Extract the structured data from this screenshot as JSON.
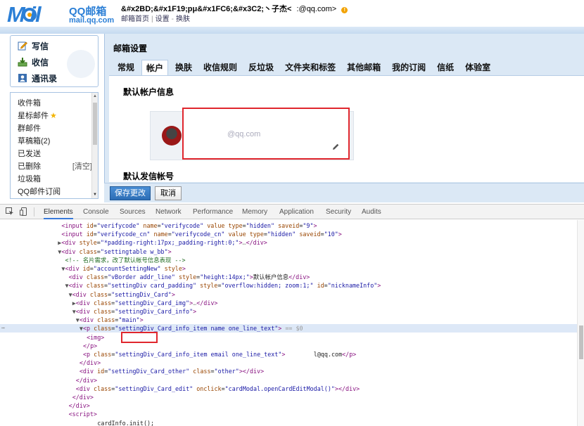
{
  "header": {
    "logo_text": "M il",
    "brand_name": "QQ邮箱",
    "brand_domain": "mail.qq.com",
    "user_name": "&#x2BD;&#x1F19;pμ&#x1FC6;&#x3C2;丶子杰<",
    "user_email": ":@qq.com>",
    "warn_icon": "!",
    "links": [
      "邮箱首页",
      "设置",
      "换肤"
    ]
  },
  "left": {
    "quick": [
      {
        "label": "写信",
        "icon": "write-icon"
      },
      {
        "label": "收信",
        "icon": "inbox-download-icon"
      },
      {
        "label": "通讯录",
        "icon": "contacts-icon"
      }
    ],
    "folders": [
      {
        "label": "收件箱"
      },
      {
        "label": "星标邮件",
        "star": "★"
      },
      {
        "label": "群邮件"
      },
      {
        "label": "草稿箱(2)"
      },
      {
        "label": "已发送"
      },
      {
        "label": "已删除",
        "action": "[清空]"
      },
      {
        "label": "垃圾箱"
      },
      {
        "label": "QQ邮件订阅"
      }
    ]
  },
  "main": {
    "title": "邮箱设置",
    "tabs": [
      "常规",
      "帐户",
      "换肤",
      "收信规则",
      "反垃圾",
      "文件夹和标签",
      "其他邮箱",
      "我的订阅",
      "信纸",
      "体验室"
    ],
    "active_tab": "帐户",
    "section_default_info": "默认帐户信息",
    "card_email": "@qq.com",
    "section_default_send": "默认发信帐号",
    "save_button": "保存更改",
    "cancel_button": "取消"
  },
  "devtools": {
    "tabs": [
      "Elements",
      "Console",
      "Sources",
      "Network",
      "Performance",
      "Memory",
      "Application",
      "Security",
      "Audits"
    ],
    "active_tab": "Elements",
    "lines": [
      {
        "indent": 14,
        "html": "<span class=\"tag\">&lt;input</span> <span class=\"at\">id</span>=<span class=\"av\">\"verifycode\"</span> <span class=\"at\">name</span>=<span class=\"av\">\"verifycode\"</span> <span class=\"at\">value</span> <span class=\"at\">type</span>=<span class=\"av\">\"hidden\"</span> <span class=\"at\">saveid</span>=<span class=\"av\">\"9\"</span><span class=\"tag\">&gt;</span>"
      },
      {
        "indent": 14,
        "html": "<span class=\"tag\">&lt;input</span> <span class=\"at\">id</span>=<span class=\"av\">\"verifycode_cn\"</span> <span class=\"at\">name</span>=<span class=\"av\">\"verifycode_cn\"</span> <span class=\"at\">value</span> <span class=\"at\">type</span>=<span class=\"av\">\"hidden\"</span> <span class=\"at\">saveid</span>=<span class=\"av\">\"10\"</span><span class=\"tag\">&gt;</span>"
      },
      {
        "indent": 13,
        "html": "<span class=\"tri\">▶</span><span class=\"tag\">&lt;div</span> <span class=\"at\">style</span>=<span class=\"av\">\"*padding-right:17px;_padding-right:0;\"</span><span class=\"tag\">&gt;</span><span class=\"ell\">…</span><span class=\"tag\">&lt;/div&gt;</span>"
      },
      {
        "indent": 13,
        "html": "<span class=\"tri\">▼</span><span class=\"tag\">&lt;div</span> <span class=\"at\">class</span>=<span class=\"av\">\"settingtable w_bb\"</span><span class=\"tag\">&gt;</span>"
      },
      {
        "indent": 15,
        "html": "<span class=\"cm\">&lt;!-- 名片需求，改了默认帐号信息表现 --&gt;</span>"
      },
      {
        "indent": 14,
        "html": "<span class=\"tri\">▼</span><span class=\"tag\">&lt;div</span> <span class=\"at\">id</span>=<span class=\"av\">\"accountSettingNew\"</span> <span class=\"at\">style</span><span class=\"tag\">&gt;</span>"
      },
      {
        "indent": 16,
        "html": "<span class=\"tag\">&lt;div</span> <span class=\"at\">class</span>=<span class=\"av\">\"vBorder addr_line\"</span> <span class=\"at\">style</span>=<span class=\"av\">\"height:14px;\"</span><span class=\"tag\">&gt;</span><span class=\"tx\">默认帐户信息</span><span class=\"tag\">&lt;/div&gt;</span>"
      },
      {
        "indent": 15,
        "html": "<span class=\"tri\">▼</span><span class=\"tag\">&lt;div</span> <span class=\"at\">class</span>=<span class=\"av\">\"settingDiv card_padding\"</span> <span class=\"at\">style</span>=<span class=\"av\">\"overflow:hidden; zoom:1;\"</span> <span class=\"at\">id</span>=<span class=\"av\">\"nicknameInfo\"</span><span class=\"tag\">&gt;</span>"
      },
      {
        "indent": 16,
        "html": "<span class=\"tri\">▼</span><span class=\"tag\">&lt;div</span> <span class=\"at\">class</span>=<span class=\"av\">\"settingDiv_Card\"</span><span class=\"tag\">&gt;</span>"
      },
      {
        "indent": 17,
        "html": "<span class=\"tri\">▶</span><span class=\"tag\">&lt;div</span> <span class=\"at\">class</span>=<span class=\"av\">\"settingDiv_Card_img\"</span><span class=\"tag\">&gt;</span><span class=\"ell\">…</span><span class=\"tag\">&lt;/div&gt;</span>"
      },
      {
        "indent": 17,
        "html": "<span class=\"tri\">▼</span><span class=\"tag\">&lt;div</span> <span class=\"at\">class</span>=<span class=\"av\">\"settingDiv_Card_info\"</span><span class=\"tag\">&gt;</span>"
      },
      {
        "indent": 18,
        "html": "<span class=\"tri\">▼</span><span class=\"tag\">&lt;div</span> <span class=\"at\">class</span>=<span class=\"av\">\"main\"</span><span class=\"tag\">&gt;</span>"
      },
      {
        "indent": 19,
        "sel": true,
        "html": "<span class=\"tri\">▼</span><span class=\"tag\">&lt;p</span> <span class=\"at\">class</span>=<span class=\"av\">\"settingDiv_Card_info_item name one_line_text\"</span><span class=\"tag\">&gt;</span> <span class=\"ell\">== $0</span>"
      },
      {
        "indent": 21,
        "html": "<span class=\"tag\">&lt;img&gt;</span>"
      },
      {
        "indent": 20,
        "html": "<span class=\"tag\">&lt;/p&gt;</span>"
      },
      {
        "indent": 20,
        "html": "<span class=\"tag\">&lt;p</span> <span class=\"at\">class</span>=<span class=\"av\">\"settingDiv_Card_info_item email one_line_text\"</span><span class=\"tag\">&gt;</span>        <span class=\"tx\">l@qq.com</span><span class=\"tag\">&lt;/p&gt;</span>"
      },
      {
        "indent": 19,
        "html": "<span class=\"tag\">&lt;/div&gt;</span>"
      },
      {
        "indent": 19,
        "html": "<span class=\"tag\">&lt;div</span> <span class=\"at\">id</span>=<span class=\"av\">\"settingDiv_Card_other\"</span> <span class=\"at\">class</span>=<span class=\"av\">\"other\"</span><span class=\"tag\">&gt;&lt;/div&gt;</span>"
      },
      {
        "indent": 18,
        "html": "<span class=\"tag\">&lt;/div&gt;</span>"
      },
      {
        "indent": 18,
        "html": "<span class=\"tag\">&lt;div</span> <span class=\"at\">class</span>=<span class=\"av\">\"settingDiv_Card_edit\"</span> <span class=\"at\">onclick</span>=<span class=\"av\">\"cardModal.openCardEditModal()\"</span><span class=\"tag\">&gt;&lt;/div&gt;</span>"
      },
      {
        "indent": 17,
        "html": "<span class=\"tag\">&lt;/div&gt;</span>"
      },
      {
        "indent": 16,
        "html": "<span class=\"tag\">&lt;/div&gt;</span>"
      },
      {
        "indent": 16,
        "html": "<span class=\"tag\">&lt;script&gt;</span>"
      },
      {
        "indent": 24,
        "html": "<span class=\"tx\">cardInfo.init();</span>"
      }
    ]
  }
}
